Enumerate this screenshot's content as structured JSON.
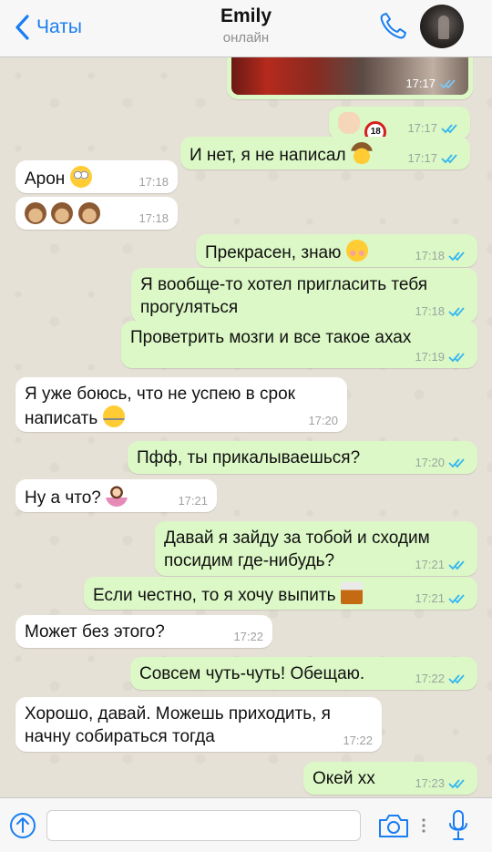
{
  "header": {
    "back_label": "Чаты",
    "contact_name": "Emily",
    "status": "онлайн"
  },
  "messages": [
    {
      "dir": "out",
      "kind": "photo",
      "time": "17:17",
      "status": "read"
    },
    {
      "dir": "out",
      "text": "",
      "emoji": [
        "victory-hand",
        "no-under-18"
      ],
      "time": "17:17",
      "status": "read"
    },
    {
      "dir": "out",
      "text": "И нет, я не написал",
      "emoji": [
        "cowboy-face"
      ],
      "time": "17:17",
      "status": "read"
    },
    {
      "dir": "in",
      "text": "Арон",
      "emoji": [
        "flushed-face"
      ],
      "time": "17:18"
    },
    {
      "dir": "in",
      "text": "",
      "emoji": [
        "see-no-evil-monkey",
        "see-no-evil-monkey",
        "see-no-evil-monkey"
      ],
      "time": "17:18"
    },
    {
      "dir": "out",
      "text": "Прекрасен, знаю",
      "emoji": [
        "smiling-face"
      ],
      "time": "17:18",
      "status": "read"
    },
    {
      "dir": "out",
      "line1": "Я вообще-то хотел пригласить тебя",
      "line2": "прогуляться",
      "time": "17:18",
      "status": "read"
    },
    {
      "dir": "out",
      "text": "Проветрить мозги и все такое ахах",
      "time": "17:19",
      "status": "read"
    },
    {
      "dir": "in",
      "line1": "Я уже боюсь, что не успею в срок",
      "line2": "написать",
      "emoji": [
        "zipper-mouth-face"
      ],
      "time": "17:20"
    },
    {
      "dir": "out",
      "text": "Пфф, ты прикалываешься?",
      "time": "17:20",
      "status": "read"
    },
    {
      "dir": "in",
      "text": "Ну а что?",
      "emoji": [
        "person-shrugging"
      ],
      "time": "17:21"
    },
    {
      "dir": "out",
      "line1": "Давай я зайду за тобой и сходим",
      "line2": "посидим где-нибудь?",
      "time": "17:21",
      "status": "read"
    },
    {
      "dir": "out",
      "text": "Если честно, то я хочу выпить",
      "emoji": [
        "tumbler-glass"
      ],
      "time": "17:21",
      "status": "read"
    },
    {
      "dir": "in",
      "text": "Может без этого?",
      "time": "17:22"
    },
    {
      "dir": "out",
      "text": "Совсем чуть-чуть! Обещаю.",
      "time": "17:22",
      "status": "read"
    },
    {
      "dir": "in",
      "line1": "Хорошо, давай. Можешь приходить, я",
      "line2": "начну собираться тогда",
      "time": "17:22"
    },
    {
      "dir": "out",
      "text": "Окей хх",
      "time": "17:23",
      "status": "read"
    }
  ],
  "input": {
    "placeholder": ""
  },
  "icons": {
    "back": "chevron-left-icon",
    "call": "phone-icon",
    "attach": "upload-icon",
    "camera": "camera-icon",
    "mic": "microphone-icon"
  },
  "colors": {
    "accent": "#1a7ef2",
    "outgoing_bubble": "#dcf8c6",
    "incoming_bubble": "#ffffff",
    "read_ticks": "#34b7f1",
    "wallpaper": "#e6e1d6"
  }
}
